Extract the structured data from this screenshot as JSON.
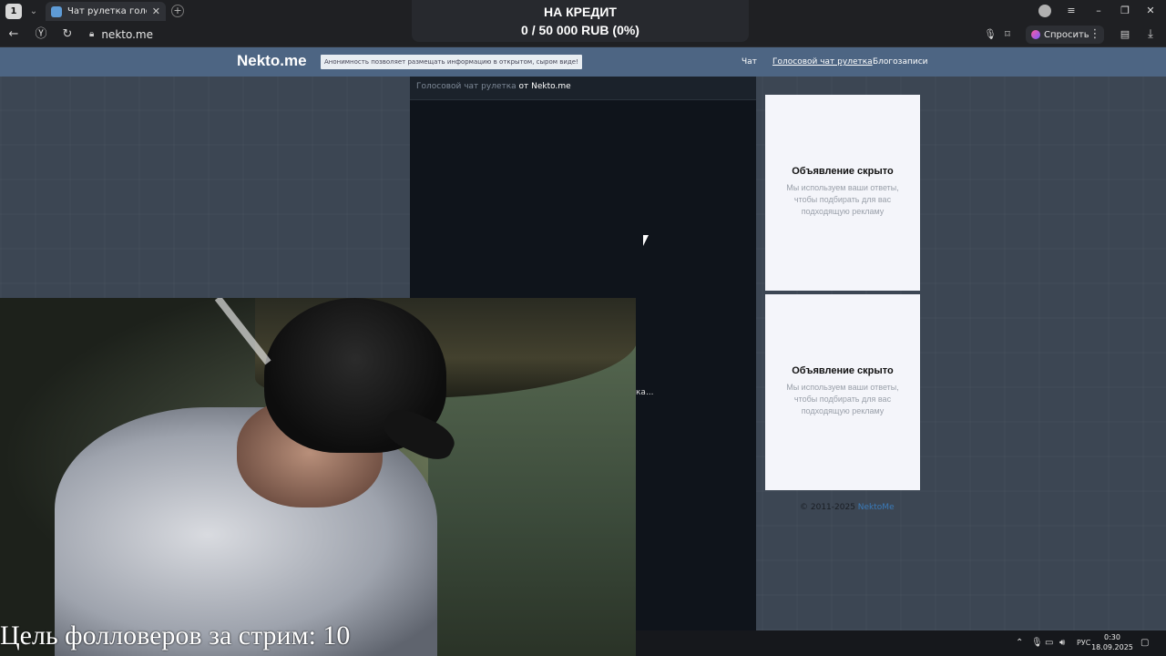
{
  "browser": {
    "tab_count_badge": "1",
    "tab_title": "Чат рулетка голосовая",
    "tab_close": "✕",
    "new_tab": "+",
    "url": "nekto.me",
    "ask_label": "Спросить"
  },
  "stream_overlay": {
    "credit_title": "НА КРЕДИТ",
    "credit_progress": "0 / 50 000 RUB (0%)",
    "followers_goal": "Цель фолловеров за стрим: 10"
  },
  "site": {
    "logo": "Nekto.me",
    "tagline": "Анонимность позволяет размещать информацию в открытом, сыром виде!",
    "nav": [
      {
        "label": "Чат"
      },
      {
        "label": "Голосовой чат рулетка"
      },
      {
        "label": "Блогозаписи"
      }
    ],
    "panel_title_link": "Голосовой чат рулетка",
    "panel_title_rest": " от Nekto.me",
    "truncated_text": "ка..."
  },
  "ads": [
    {
      "title": "Объявление скрыто",
      "subtitle": "Мы используем ваши ответы, чтобы подбирать для вас подходящую рекламу"
    },
    {
      "title": "Объявление скрыто",
      "subtitle": "Мы используем ваши ответы, чтобы подбирать для вас подходящую рекламу"
    }
  ],
  "footer": {
    "copyright": "© 2011-2025 ",
    "brand": "NektoMe"
  },
  "taskbar": {
    "lang": "РУС",
    "time": "0:30",
    "date": "18.09.2025"
  }
}
